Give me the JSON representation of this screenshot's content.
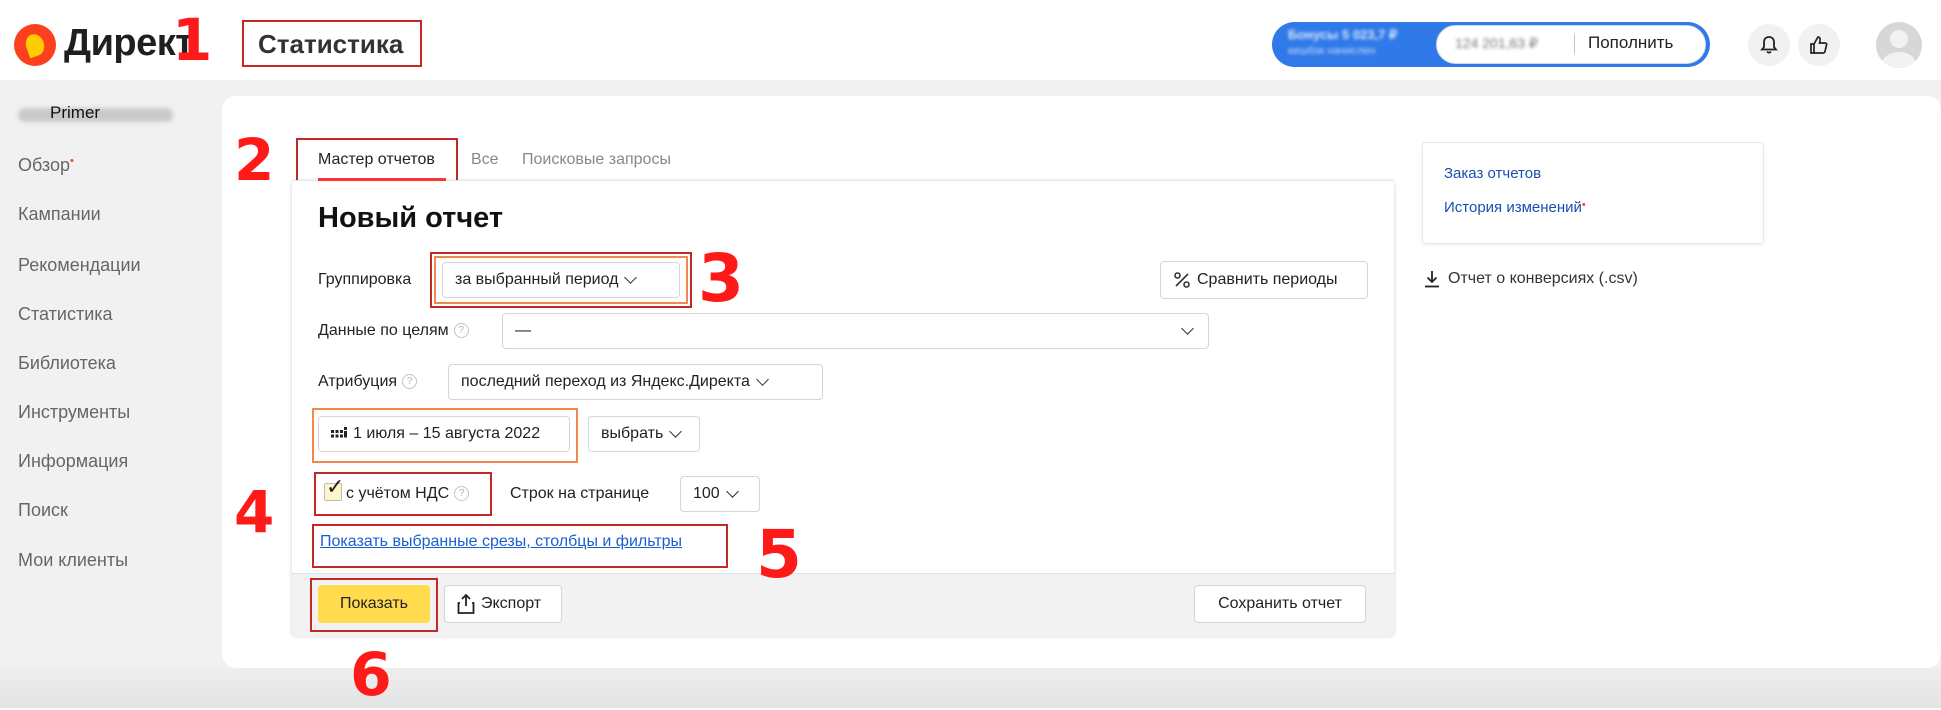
{
  "header": {
    "logo": "Директ",
    "page_title": "Статистика",
    "balance_main": "Бонусы 5 023,7 ₽",
    "balance_sub": "кешбэк начислен",
    "account_amount": "124 201,63 ₽",
    "topup_label": "Пополнить"
  },
  "markers": [
    "1",
    "2",
    "3",
    "4",
    "5",
    "6"
  ],
  "sidebar": {
    "user": "Primer",
    "items": [
      {
        "label": "Обзор",
        "badge": "•"
      },
      {
        "label": "Кампании"
      },
      {
        "label": "Рекомендации"
      },
      {
        "label": "Статистика"
      },
      {
        "label": "Библиотека"
      },
      {
        "label": "Инструменты"
      },
      {
        "label": "Информация"
      },
      {
        "label": "Поиск"
      },
      {
        "label": "Мои клиенты"
      }
    ]
  },
  "tabs": [
    "Мастер отчетов",
    "Все",
    "Поисковые запросы"
  ],
  "report": {
    "title": "Новый отчет",
    "grouping_label": "Группировка",
    "grouping_value": "за выбранный период",
    "compare_label": "Сравнить периоды",
    "goals_label": "Данные по целям",
    "goals_value": "—",
    "attribution_label": "Атрибуция",
    "attribution_value": "последний переход из Яндекс.Директа",
    "date_range": "1 июля – 15 августа 2022",
    "period_select": "выбрать",
    "vat_label": "с учётом НДС",
    "rows_label": "Строк на странице",
    "rows_value": "100",
    "show_slices_link": "Показать выбранные срезы, столбцы и фильтры",
    "show_button": "Показать",
    "export_button": "Экспорт",
    "save_button": "Сохранить отчет"
  },
  "side_links": {
    "order_report": "Заказ отчетов",
    "change_history": "История изменений",
    "badge": "•",
    "csv": "Отчет о конверсиях (.csv)"
  },
  "colors": {
    "accent_red": "#ff1a1a",
    "highlight_orange": "#f0894f",
    "primary_yellow": "#ffdb4d",
    "link_blue": "#1a5fd0",
    "balance_blue": "#2f79e8"
  }
}
